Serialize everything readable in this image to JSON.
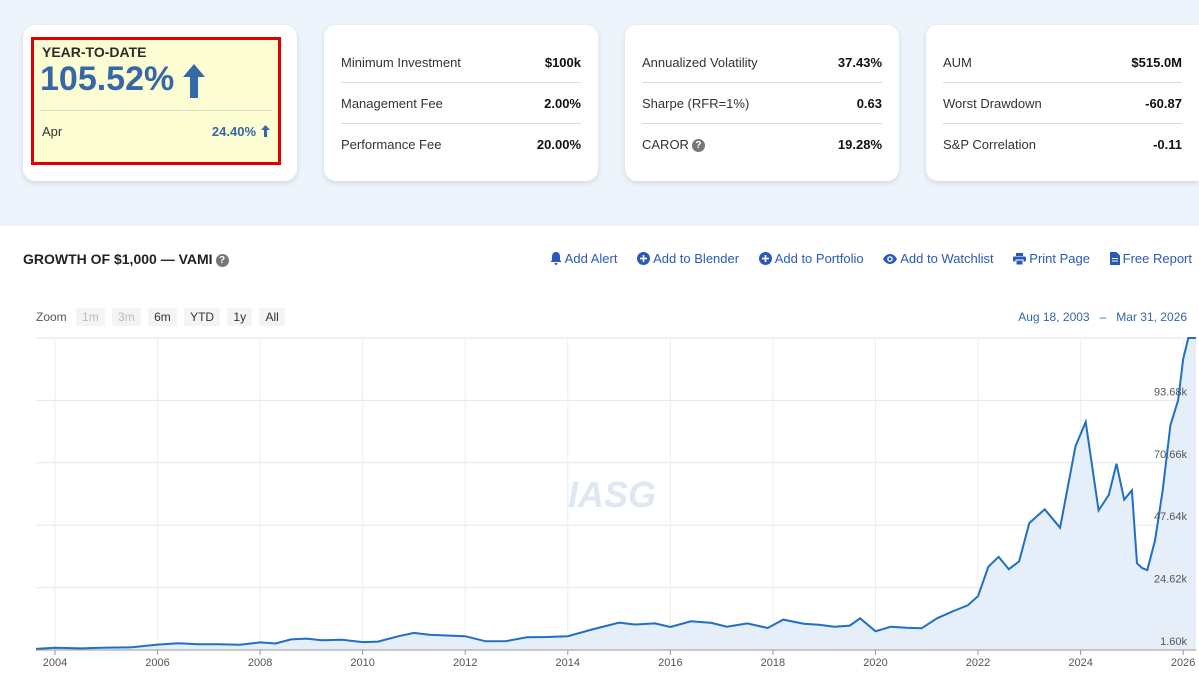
{
  "ytd_card": {
    "label": "YEAR-TO-DATE",
    "value": "105.52%",
    "month": "Apr",
    "month_value": "24.40%"
  },
  "stats_cards": [
    [
      {
        "label": "Minimum Investment",
        "value": "$100k"
      },
      {
        "label": "Management Fee",
        "value": "2.00%"
      },
      {
        "label": "Performance Fee",
        "value": "20.00%"
      }
    ],
    [
      {
        "label": "Annualized Volatility",
        "value": "37.43%"
      },
      {
        "label": "Sharpe (RFR=1%)",
        "value": "0.63"
      },
      {
        "label": "CAROR",
        "value": "19.28%"
      }
    ],
    [
      {
        "label": "AUM",
        "value": "$515.0M"
      },
      {
        "label": "Worst Drawdown",
        "value": "-60.87"
      },
      {
        "label": "S&P Correlation",
        "value": "-0.11"
      }
    ]
  ],
  "section": {
    "title": "GROWTH OF $1,000 — VAMI"
  },
  "actions": {
    "add_alert": "Add Alert",
    "add_blender": "Add to Blender",
    "add_portfolio": "Add to Portfolio",
    "add_watchlist": "Add to Watchlist",
    "print_page": "Print Page",
    "free_report": "Free Report"
  },
  "zoom": {
    "label": "Zoom",
    "options": [
      "1m",
      "3m",
      "6m",
      "YTD",
      "1y",
      "All"
    ]
  },
  "range": {
    "from": "Aug 18, 2003",
    "to": "Mar 31, 2026"
  },
  "watermark": "IASG",
  "colors": {
    "accent": "#3667a6",
    "line": "#1f6fc5",
    "area": "#e6eef9",
    "highlight": "#e00000"
  },
  "chart_data": {
    "type": "area",
    "xlabel": "",
    "ylabel": "",
    "x_ticks": [
      "2004",
      "2006",
      "2008",
      "2010",
      "2012",
      "2014",
      "2016",
      "2018",
      "2020",
      "2022",
      "2024",
      "2026"
    ],
    "y_ticks": [
      "1.60k",
      "24.62k",
      "47.64k",
      "70.66k",
      "93.68k"
    ],
    "ylim": [
      1600,
      116700
    ],
    "xlim": [
      2003.63,
      2026.25
    ],
    "series": [
      {
        "x": [
          2003.63,
          2004.0,
          2004.5,
          2005.0,
          2005.5,
          2006.0,
          2006.4,
          2006.8,
          2007.2,
          2007.6,
          2008.0,
          2008.3,
          2008.6,
          2008.9,
          2009.2,
          2009.6,
          2010.0,
          2010.3,
          2010.7,
          2011.0,
          2011.3,
          2011.7,
          2012.0,
          2012.4,
          2012.8,
          2013.2,
          2013.6,
          2014.0,
          2014.5,
          2015.0,
          2015.3,
          2015.7,
          2016.0,
          2016.4,
          2016.8,
          2017.1,
          2017.5,
          2017.9,
          2018.2,
          2018.6,
          2018.9,
          2019.2,
          2019.5,
          2019.7,
          2020.0,
          2020.3,
          2020.6,
          2020.9,
          2021.2,
          2021.5,
          2021.8,
          2022.0,
          2022.2,
          2022.4,
          2022.6,
          2022.8,
          2023.0,
          2023.3,
          2023.6,
          2023.9,
          2024.1,
          2024.35,
          2024.55,
          2024.7,
          2024.85,
          2025.0,
          2025.1,
          2025.2,
          2025.3,
          2025.45,
          2025.6,
          2025.75,
          2025.9,
          2026.0,
          2026.1,
          2026.18,
          2026.25
        ],
        "y": [
          2000,
          2400,
          2200,
          2500,
          2600,
          3600,
          4100,
          3700,
          3700,
          3500,
          4400,
          4000,
          5500,
          5800,
          5200,
          5400,
          4500,
          4700,
          6700,
          7900,
          7200,
          6900,
          6700,
          4800,
          4900,
          6300,
          6400,
          6700,
          9300,
          11700,
          11000,
          11400,
          10100,
          12200,
          11600,
          10200,
          11400,
          9700,
          12800,
          11300,
          10900,
          10200,
          10600,
          13300,
          8500,
          10200,
          9800,
          9600,
          13300,
          15800,
          18100,
          21500,
          32300,
          36000,
          31400,
          34300,
          48400,
          53500,
          46700,
          76800,
          85700,
          53100,
          58800,
          70300,
          57100,
          60500,
          33600,
          31800,
          31100,
          42000,
          60500,
          84500,
          93700,
          109000,
          116700,
          116700,
          116700
        ]
      }
    ]
  }
}
